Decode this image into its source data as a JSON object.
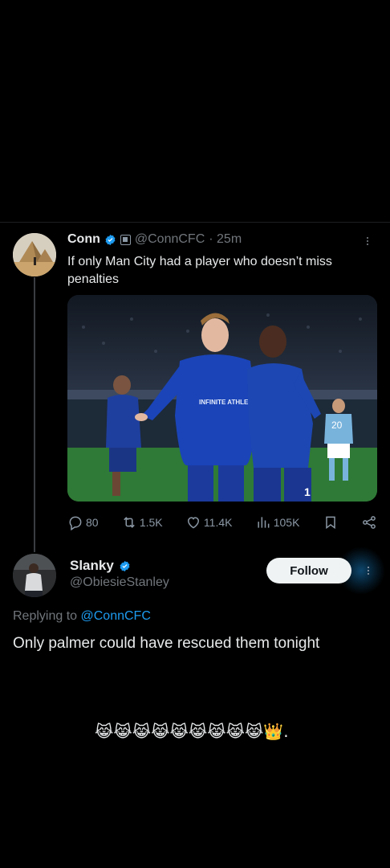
{
  "quoted_tweet": {
    "name": "Conn",
    "handle": "@ConnCFC",
    "time": "· 25m",
    "text": "If only Man City had a player who doesn’t miss penalties",
    "media_kit_text": "INFINITE ATHLETE",
    "media_number": "20",
    "stats": {
      "replies": "80",
      "reposts": "1.5K",
      "likes": "11.4K",
      "views": "105K"
    }
  },
  "reply": {
    "name": "Slanky",
    "handle": "@ObiesieStanley",
    "follow_label": "Follow",
    "replying_prefix": "Replying to ",
    "replying_to": "@ConnCFC",
    "text": "Only palmer could have rescued them tonight",
    "emojis": "😹😹😹😹😹😹😹😹😹👑."
  },
  "colors": {
    "background": "#000000",
    "accent": "#1d9bf0",
    "muted": "#71767b",
    "text": "#e7e9ea"
  },
  "icons": [
    "verified-badge-icon",
    "affiliate-box-icon",
    "more-icon",
    "reply-icon",
    "repost-icon",
    "like-icon",
    "views-icon",
    "bookmark-icon",
    "share-icon"
  ]
}
